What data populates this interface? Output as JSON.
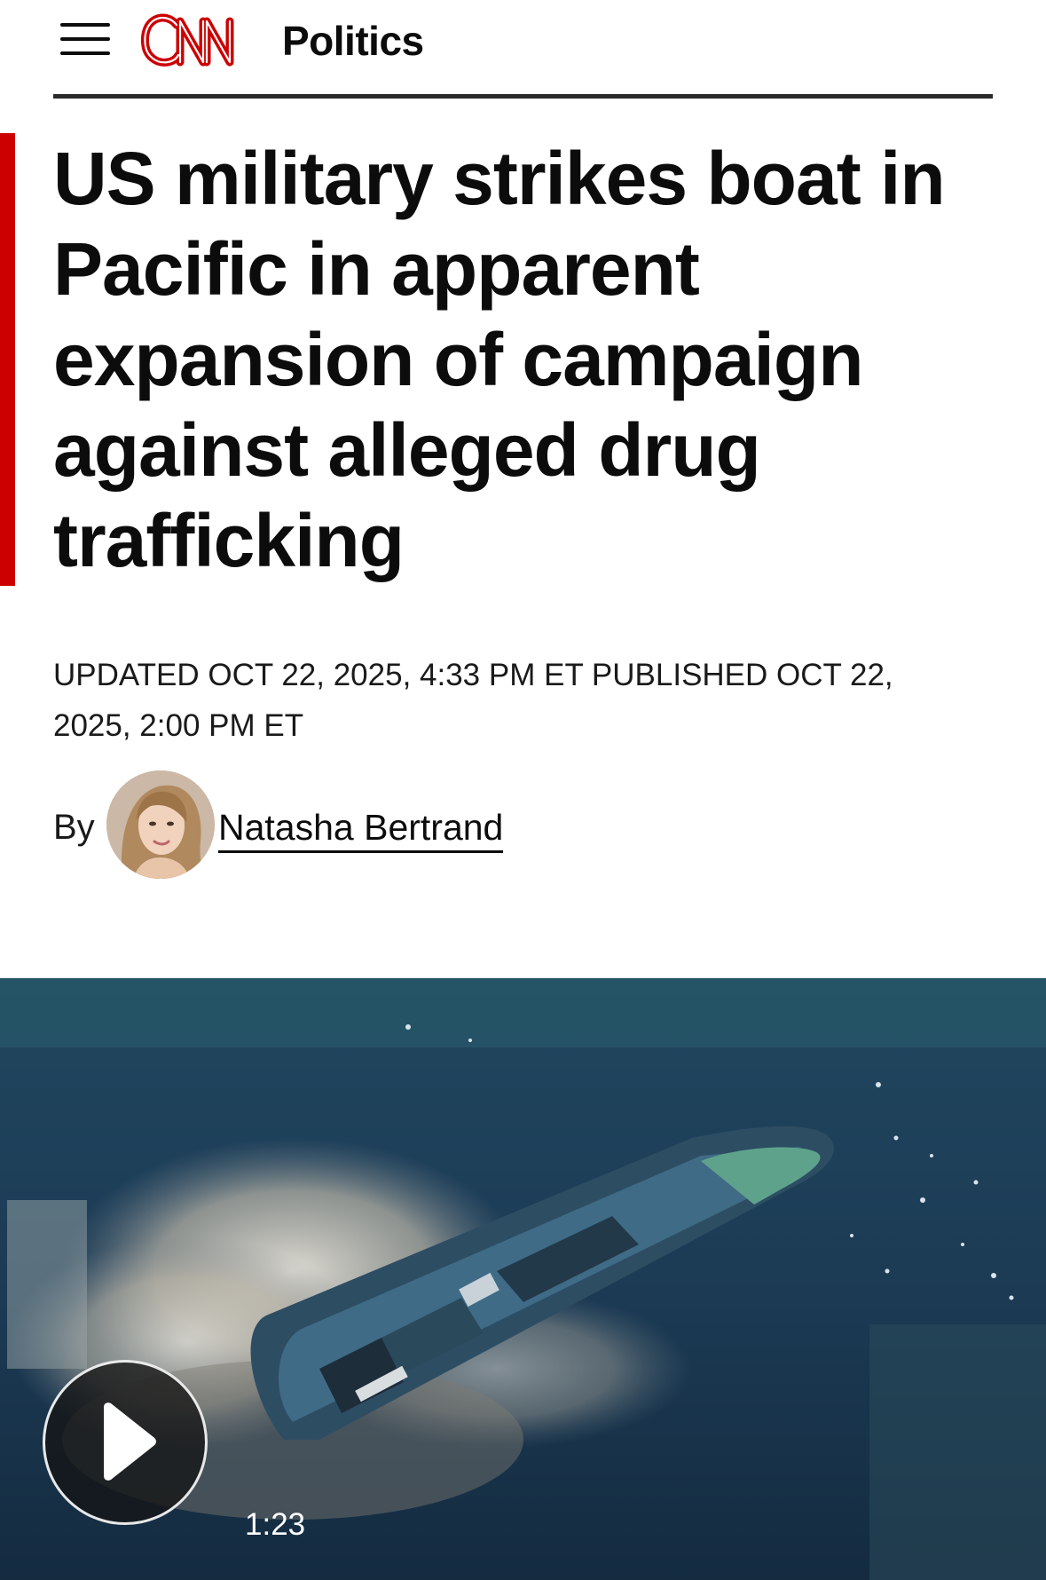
{
  "header": {
    "brand": "CNN",
    "section": "Politics",
    "brand_color": "#cc0000",
    "menu_icon": "hamburger-menu-icon"
  },
  "article": {
    "headline": "US military strikes boat in Pacific in apparent expansion of campaign against alleged drug trafficking",
    "timestamp": "UPDATED OCT 22, 2025, 4:33 PM ET PUBLISHED OCT 22, 2025, 2:00 PM ET",
    "byline": {
      "prefix": "By",
      "author": "Natasha Bertrand"
    },
    "accent_color": "#cc0000"
  },
  "video": {
    "duration": "1:23",
    "play_icon": "play-icon"
  }
}
